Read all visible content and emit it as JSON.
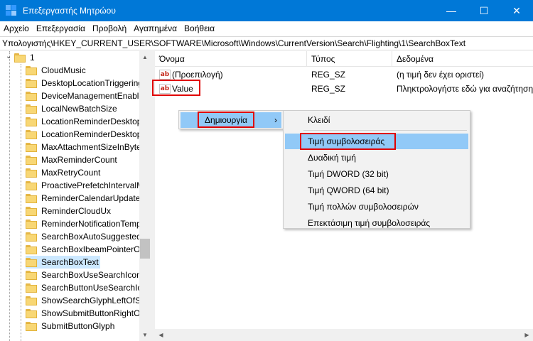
{
  "window": {
    "title": "Επεξεργαστής Μητρώου",
    "controls": {
      "minimize": "—",
      "maximize": "☐",
      "close": "✕"
    },
    "accent": "#0078d7"
  },
  "menu": [
    "Αρχείο",
    "Επεξεργασία",
    "Προβολή",
    "Αγαπημένα",
    "Βοήθεια"
  ],
  "address": "Υπολογιστής\\HKEY_CURRENT_USER\\SOFTWARE\\Microsoft\\Windows\\CurrentVersion\\Search\\Flighting\\1\\SearchBoxText",
  "tree": {
    "parent": "1",
    "items": [
      "CloudMusic",
      "DesktopLocationTriggering",
      "DeviceManagementEnable",
      "LocalNewBatchSize",
      "LocationReminderDesktop",
      "LocationReminderDesktop",
      "MaxAttachmentSizeInByte",
      "MaxReminderCount",
      "MaxRetryCount",
      "ProactivePrefetchIntervalM",
      "ReminderCalendarUpdate",
      "ReminderCloudUx",
      "ReminderNotificationTemp",
      "SearchBoxAutoSuggestedF",
      "SearchBoxIbeamPointerOr",
      "SearchBoxText",
      "SearchBoxUseSearchIconA",
      "SearchButtonUseSearchIco",
      "ShowSearchGlyphLeftOfSe",
      "ShowSubmitButtonRightO",
      "SubmitButtonGlyph"
    ],
    "selected_index": 15
  },
  "columns": {
    "name": "Όνομα",
    "type": "Τύπος",
    "data": "Δεδομένα"
  },
  "values": [
    {
      "name": "(Προεπιλογή)",
      "type": "REG_SZ",
      "data": "(η τιμή δεν έχει οριστεί)",
      "icon": "ab-string-icon"
    },
    {
      "name": "Value",
      "type": "REG_SZ",
      "data": "Πληκτρολογήστε εδώ για αναζήτηση",
      "icon": "ab-string-icon"
    }
  ],
  "context_menu": {
    "item": "Δημιουργία",
    "arrow": "›"
  },
  "submenu": {
    "key": "Κλειδί",
    "items": [
      "Τιμή συμβολοσειράς",
      "Δυαδική τιμή",
      "Τιμή DWORD (32 bit)",
      "Τιμή QWORD (64 bit)",
      "Τιμή πολλών συμβολοσειρών",
      "Επεκτάσιμη τιμή συμβολοσειράς"
    ],
    "highlighted_index": 0
  },
  "highlight_color": "#e00000"
}
